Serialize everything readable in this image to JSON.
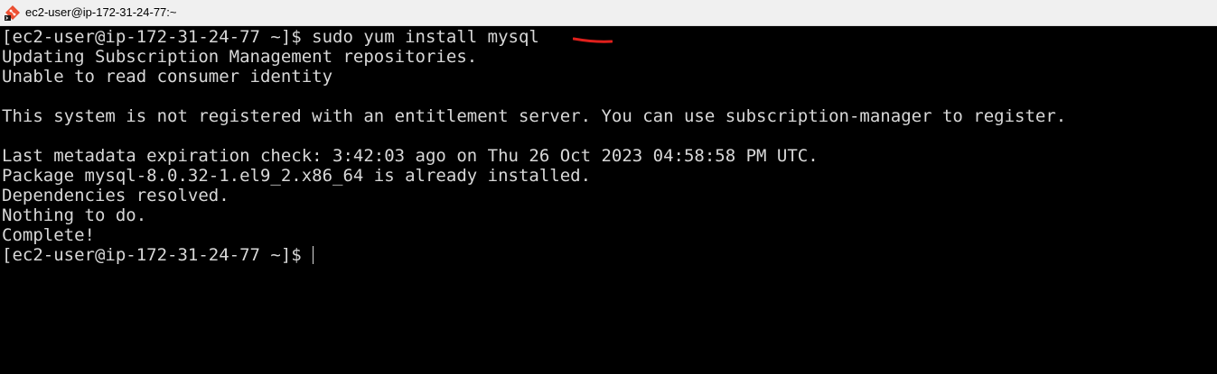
{
  "window": {
    "title": "ec2-user@ip-172-31-24-77:~"
  },
  "terminal": {
    "lines": [
      "[ec2-user@ip-172-31-24-77 ~]$ sudo yum install mysql",
      "Updating Subscription Management repositories.",
      "Unable to read consumer identity",
      "",
      "This system is not registered with an entitlement server. You can use subscription-manager to register.",
      "",
      "Last metadata expiration check: 3:42:03 ago on Thu 26 Oct 2023 04:58:58 PM UTC.",
      "Package mysql-8.0.32-1.el9_2.x86_64 is already installed.",
      "Dependencies resolved.",
      "Nothing to do.",
      "Complete!",
      "[ec2-user@ip-172-31-24-77 ~]$"
    ]
  },
  "colors": {
    "background": "#000000",
    "text": "#d8d8d8",
    "annotation": "#e0201c"
  },
  "icons": {
    "title": "git-bash-icon",
    "annotation": "red-underline-mark"
  }
}
